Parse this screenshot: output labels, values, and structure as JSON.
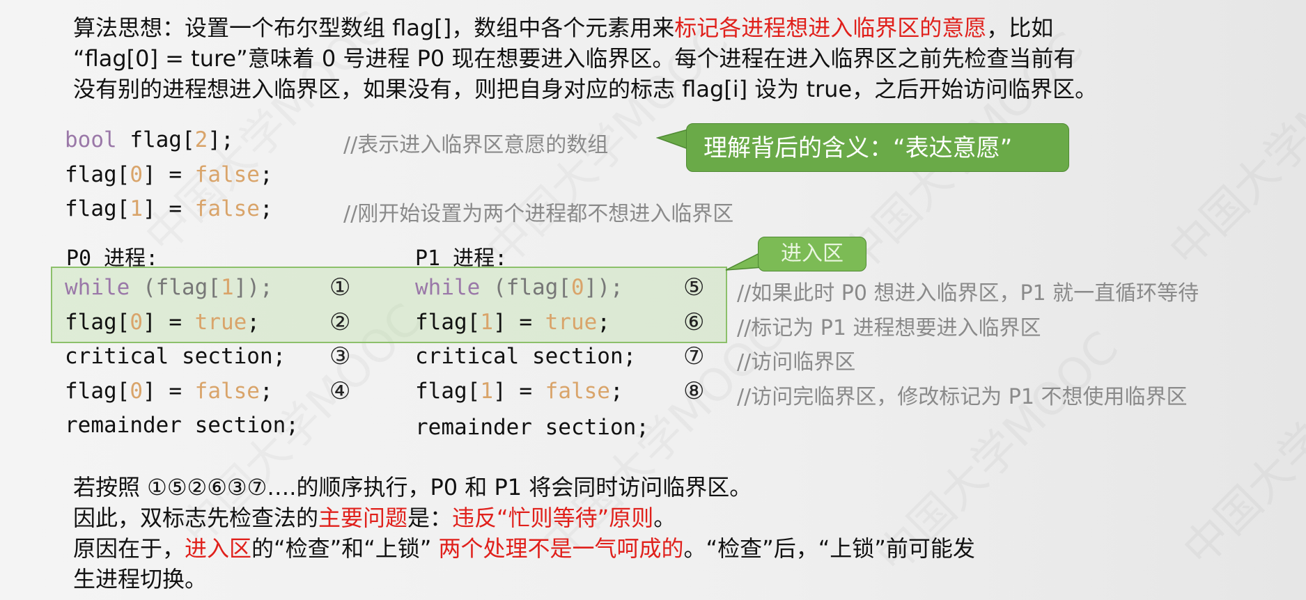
{
  "intro": {
    "p1": "算法思想：设置一个布尔型数组 flag[]，数组中各个元素用来",
    "p1_red": "标记各进程想进入临界区的意愿",
    "p1_end": "，比如",
    "p2": "“flag[0] = ture”意味着 0 号进程 P0 现在想要进入临界区。每个进程在进入临界区之前先检查当前有",
    "p3": "没有别的进程想进入临界区，如果没有，则把自身对应的标志 flag[i] 设为 true，之后开始访问临界区。"
  },
  "decl": {
    "l1_type": "bool",
    "l1_a": " flag[",
    "l1_n": "2",
    "l1_b": "];",
    "l1_comment": "//表示进入临界区意愿的数组",
    "l2_a": "flag[",
    "l2_n": "0",
    "l2_b": "] = ",
    "l2_v": "false",
    "l2_c": ";",
    "l3_a": "flag[",
    "l3_n": "1",
    "l3_b": "] = ",
    "l3_v": "false",
    "l3_c": ";",
    "l3_comment": "//刚开始设置为两个进程都不想进入临界区"
  },
  "callouts": {
    "meaning": "理解背后的含义：“表达意愿”",
    "entry": "进入区"
  },
  "p0": {
    "title": "P0 进程:",
    "w_kw": "while",
    "w_a": " (flag[",
    "w_n": "1",
    "w_b": "]);",
    "s_a": "flag[",
    "s_n": "0",
    "s_b": "] = ",
    "s_v": "true",
    "s_c": ";",
    "cs": "critical section;",
    "r_a": "flag[",
    "r_n": "0",
    "r_b": "] = ",
    "r_v": "false",
    "r_c": ";",
    "rem": "remainder section;",
    "steps": [
      "①",
      "②",
      "③",
      "④"
    ]
  },
  "p1": {
    "title": "P1 进程:",
    "w_kw": "while",
    "w_a": " (flag[",
    "w_n": "0",
    "w_b": "]);",
    "s_a": "flag[",
    "s_n": "1",
    "s_b": "] = ",
    "s_v": "true",
    "s_c": ";",
    "cs": "critical section;",
    "r_a": "flag[",
    "r_n": "1",
    "r_b": "] = ",
    "r_v": "false",
    "r_c": ";",
    "rem": "remainder section;",
    "steps": [
      "⑤",
      "⑥",
      "⑦",
      "⑧"
    ]
  },
  "comments": [
    "//如果此时 P0 想进入临界区，P1 就一直循环等待",
    "//标记为 P1 进程想要进入临界区",
    "//访问临界区",
    "//访问完临界区，修改标记为 P1 不想使用临界区"
  ],
  "outro": {
    "l1": "若按照 ①⑤②⑥③⑦….的顺序执行，P0 和 P1 将会同时访问临界区。",
    "l2_a": "因此，双标志先检查法的",
    "l2_red1": "主要问题",
    "l2_b": "是：",
    "l2_red2": "违反“忙则等待”原则",
    "l2_c": "。",
    "l3_a": "原因在于，",
    "l3_red1": "进入区",
    "l3_b": "的“检查”和“上锁” ",
    "l3_red2": "两个处理不是一气呵成的",
    "l3_c": "。“检查”后，“上锁”前可能发",
    "l4": "生进程切换。"
  },
  "watermark": "中国大学MOOC",
  "colors": {
    "callout_bg": "#6aaa48",
    "highlight_border": "#8cc06a",
    "emphasis_red": "#e0201b",
    "keyword": "#9a78a8",
    "literal": "#d9a46a"
  }
}
